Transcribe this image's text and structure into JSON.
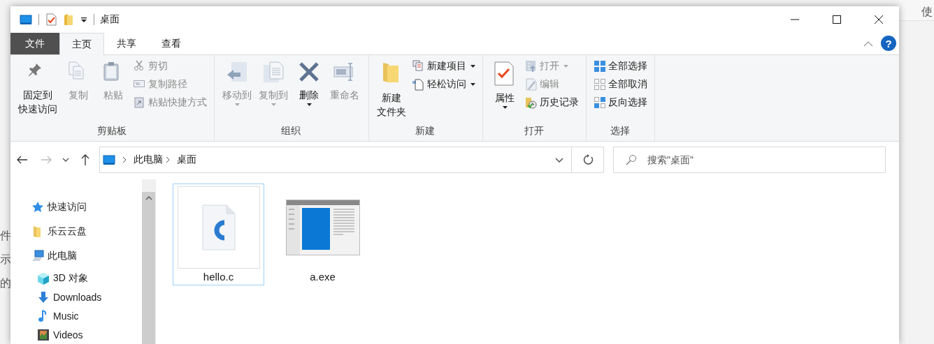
{
  "background": {
    "top_fragments": [
      "使"
    ],
    "left_fragments": [
      "件",
      "示",
      "的"
    ]
  },
  "window": {
    "title": "桌面"
  },
  "ribbon_tabs": [
    {
      "label": "文件",
      "kind": "file",
      "selected": false
    },
    {
      "label": "主页",
      "kind": "tab",
      "selected": true
    },
    {
      "label": "共享",
      "kind": "tab",
      "selected": false
    },
    {
      "label": "查看",
      "kind": "tab",
      "selected": false
    }
  ],
  "help_button": "?",
  "ribbon_groups": [
    {
      "label": "剪贴板",
      "items": [
        {
          "lines": [
            "固定到",
            "快速访问"
          ],
          "kind": "large",
          "disabled": false,
          "dropdown": false
        },
        {
          "label": "复制",
          "kind": "large",
          "disabled": true,
          "dropdown": false
        },
        {
          "label": "粘贴",
          "kind": "large",
          "disabled": true,
          "dropdown": false
        },
        {
          "label": "剪切",
          "kind": "small",
          "disabled": true,
          "dropdown": false
        },
        {
          "label": "复制路径",
          "kind": "small",
          "disabled": true,
          "dropdown": false
        },
        {
          "label": "粘贴快捷方式",
          "kind": "small",
          "disabled": true,
          "dropdown": false
        }
      ]
    },
    {
      "label": "组织",
      "items": [
        {
          "label": "移动到",
          "kind": "large",
          "disabled": true,
          "dropdown": true
        },
        {
          "label": "复制到",
          "kind": "large",
          "disabled": true,
          "dropdown": true
        },
        {
          "label": "删除",
          "kind": "large",
          "disabled": false,
          "dropdown": true
        },
        {
          "label": "重命名",
          "kind": "large",
          "disabled": true,
          "dropdown": false
        }
      ]
    },
    {
      "label": "新建",
      "items": [
        {
          "lines": [
            "新建",
            "文件夹"
          ],
          "kind": "large",
          "disabled": false,
          "dropdown": false
        },
        {
          "label": "新建项目",
          "kind": "small",
          "disabled": false,
          "dropdown": true
        },
        {
          "label": "轻松访问",
          "kind": "small",
          "disabled": false,
          "dropdown": true
        }
      ]
    },
    {
      "label": "打开",
      "items": [
        {
          "label": "属性",
          "kind": "large",
          "disabled": false,
          "dropdown": true
        },
        {
          "label": "打开",
          "kind": "small",
          "disabled": true,
          "dropdown": true
        },
        {
          "label": "编辑",
          "kind": "small",
          "disabled": true,
          "dropdown": false
        },
        {
          "label": "历史记录",
          "kind": "small",
          "disabled": false,
          "dropdown": false
        }
      ]
    },
    {
      "label": "选择",
      "items": [
        {
          "label": "全部选择",
          "kind": "small",
          "disabled": false,
          "dropdown": false
        },
        {
          "label": "全部取消",
          "kind": "small",
          "disabled": false,
          "dropdown": false
        },
        {
          "label": "反向选择",
          "kind": "small",
          "disabled": false,
          "dropdown": false
        }
      ]
    }
  ],
  "address_bar": {
    "path": [
      {
        "label": "此电脑"
      },
      {
        "label": "桌面"
      }
    ]
  },
  "search": {
    "placeholder": "搜索\"桌面\""
  },
  "navigation_pane": {
    "items": [
      {
        "label": "快速访问",
        "kind": "quick"
      },
      {
        "label": "乐云云盘",
        "kind": "folder"
      },
      {
        "label": "此电脑",
        "kind": "pc",
        "children": [
          {
            "label": "3D 对象",
            "kind": "cube"
          },
          {
            "label": "Downloads",
            "kind": "download"
          },
          {
            "label": "Music",
            "kind": "music"
          },
          {
            "label": "Videos",
            "kind": "video"
          }
        ]
      }
    ]
  },
  "files": [
    {
      "name": "hello.c",
      "kind": "source",
      "selected": true
    },
    {
      "name": "a.exe",
      "kind": "program",
      "selected": false
    }
  ]
}
